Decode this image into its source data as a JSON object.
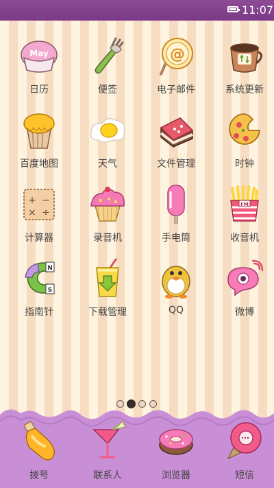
{
  "status": {
    "time": "11:07"
  },
  "apps": [
    {
      "label": "日历",
      "icon": "calendar-icon"
    },
    {
      "label": "便签",
      "icon": "notes-icon"
    },
    {
      "label": "电子邮件",
      "icon": "email-icon"
    },
    {
      "label": "系统更新",
      "icon": "system-update-icon"
    },
    {
      "label": "百度地图",
      "icon": "baidu-map-icon"
    },
    {
      "label": "天气",
      "icon": "weather-icon"
    },
    {
      "label": "文件管理",
      "icon": "file-manager-icon"
    },
    {
      "label": "时钟",
      "icon": "clock-icon"
    },
    {
      "label": "计算器",
      "icon": "calculator-icon"
    },
    {
      "label": "录音机",
      "icon": "recorder-icon"
    },
    {
      "label": "手电筒",
      "icon": "flashlight-icon"
    },
    {
      "label": "收音机",
      "icon": "radio-icon"
    },
    {
      "label": "指南针",
      "icon": "compass-icon"
    },
    {
      "label": "下载管理",
      "icon": "download-manager-icon"
    },
    {
      "label": "QQ",
      "icon": "qq-icon"
    },
    {
      "label": "微博",
      "icon": "weibo-icon"
    }
  ],
  "calendar_badge": "May",
  "radio_badge": "FM",
  "pager": {
    "pages": 4,
    "current": 2
  },
  "dock": [
    {
      "label": "拨号",
      "icon": "dialer-icon"
    },
    {
      "label": "联系人",
      "icon": "contacts-icon"
    },
    {
      "label": "浏览器",
      "icon": "browser-icon"
    },
    {
      "label": "短信",
      "icon": "messages-icon"
    }
  ],
  "colors": {
    "statusbar": "#7b3a86",
    "dock": "#c98fd6",
    "stripe_light": "#fdf3de",
    "stripe_dark": "#f6dcc1"
  }
}
